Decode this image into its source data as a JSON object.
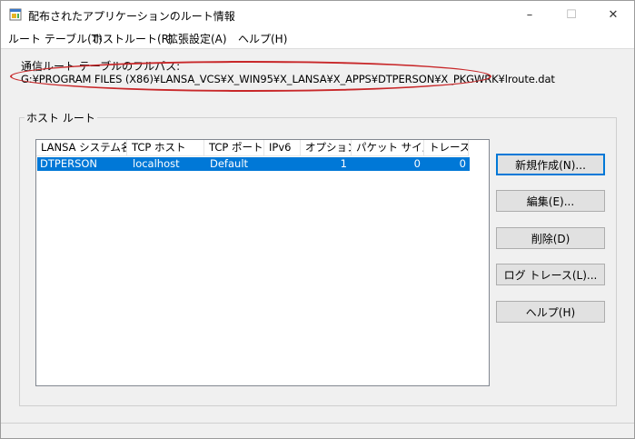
{
  "window": {
    "title": "配布されたアプリケーションのルート情報",
    "controls": {
      "minimize": "–",
      "maximize": "☐",
      "close": "✕"
    }
  },
  "menu": {
    "items": [
      "ルート テーブル(T)",
      "ホストルート(R)",
      "拡張設定(A)",
      "ヘルプ(H)"
    ]
  },
  "path": {
    "label": "通信ルート テーブルのフルパス:",
    "value": "G:¥PROGRAM FILES (X86)¥LANSA_VCS¥X_WIN95¥X_LANSA¥X_APPS¥DTPERSON¥X_PKGWRK¥lroute.dat"
  },
  "group": {
    "title": "ホスト ルート"
  },
  "table": {
    "columns": [
      "LANSA システム名",
      "TCP ホスト",
      "TCP ポート",
      "IPv6",
      "オプション",
      "パケット サイズ",
      "トレース"
    ],
    "rows": [
      {
        "system": "DTPERSON",
        "host": "localhost",
        "port": "Default",
        "ipv6": "",
        "options": "1",
        "packet_size": "0",
        "trace": "0"
      }
    ]
  },
  "buttons": {
    "new": "新規作成(N)...",
    "edit": "編集(E)...",
    "delete": "削除(D)",
    "log_trace": "ログ トレース(L)...",
    "help": "ヘルプ(H)"
  },
  "colors": {
    "selection": "#0078d7",
    "annotation_ellipse": "#c8282a"
  }
}
